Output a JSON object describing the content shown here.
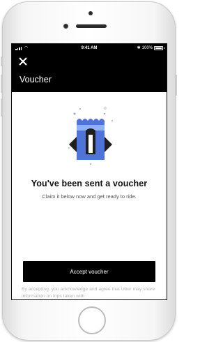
{
  "status_bar": {
    "time": "9:41 AM",
    "battery": "100%",
    "signal_icon": "signal-icon",
    "wifi_icon": "wifi-icon",
    "bluetooth_icon": "bluetooth-icon",
    "battery_icon": "battery-icon"
  },
  "header": {
    "close_icon": "close-icon",
    "title": "Voucher",
    "background": "#000000"
  },
  "hero": {
    "icon": "voucher-ticket-illustration",
    "colors": {
      "blue": "#4f73d8",
      "light_blue": "#8fb3f0",
      "dark": "#1f1f1f"
    }
  },
  "main": {
    "headline": "You've been sent a voucher",
    "subline": "Claim it below now and get ready to ride."
  },
  "actions": {
    "accept_label": "Accept voucher"
  },
  "legal": {
    "text": "By accepting, you acknowledge and agree that Uber may share information on trips taken with"
  }
}
